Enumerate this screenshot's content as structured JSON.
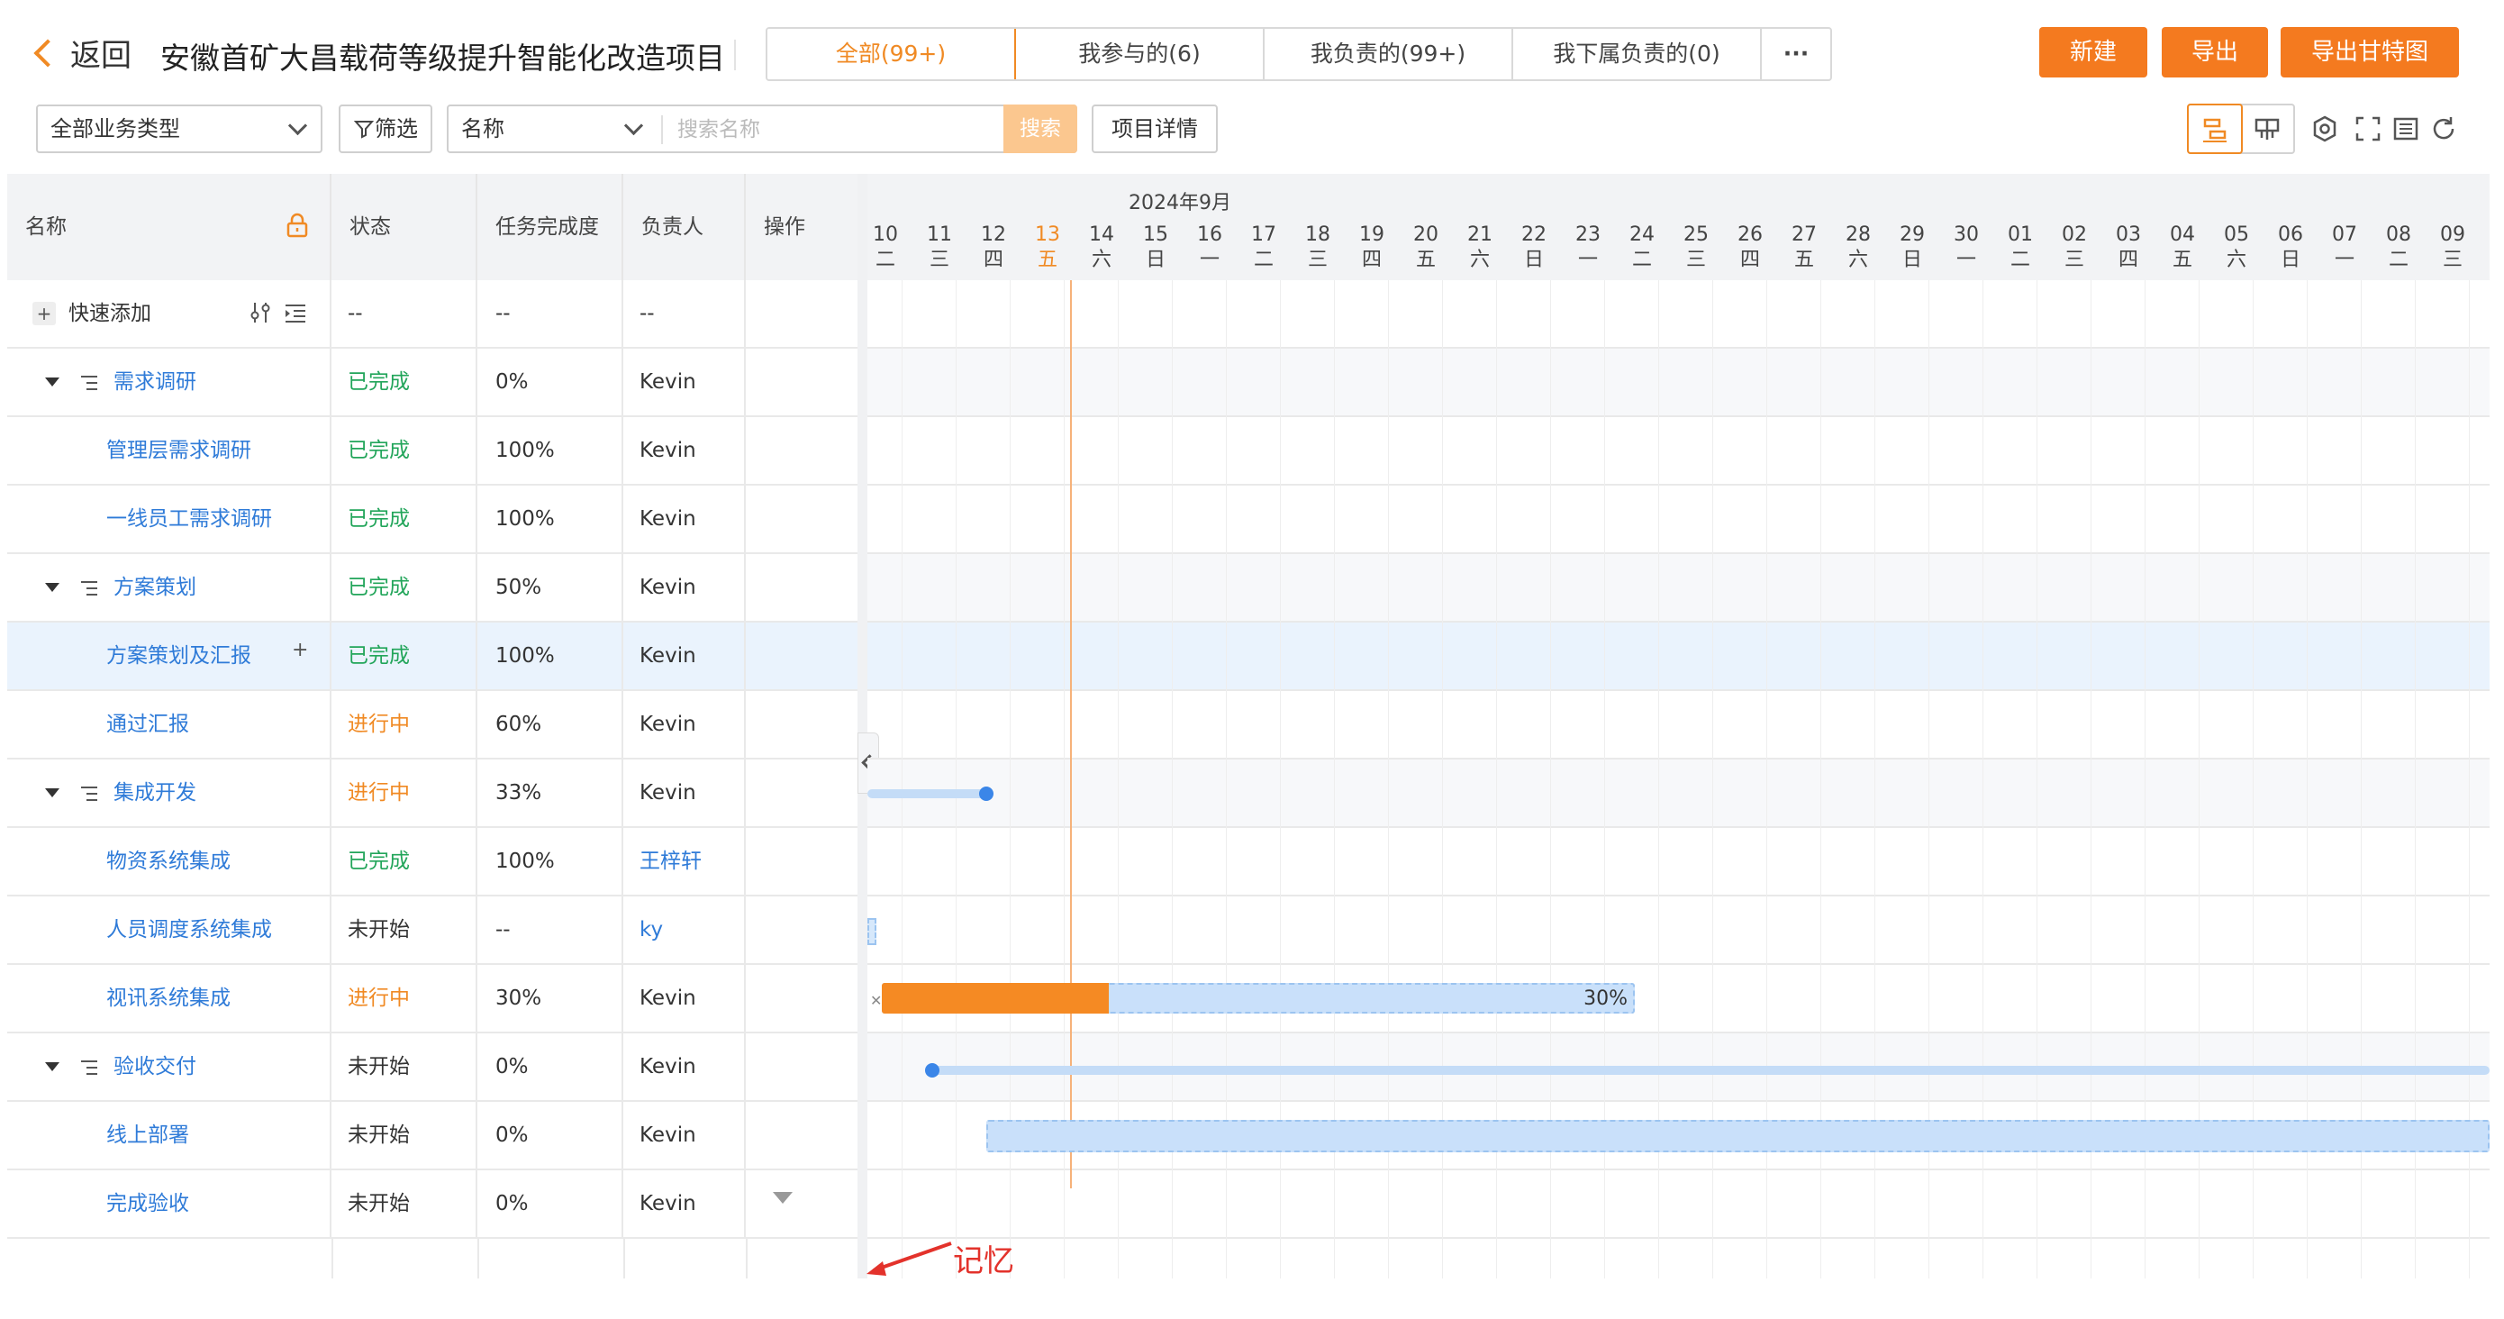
{
  "header": {
    "back_label": "返回",
    "project_title": "安徽首矿大昌载荷等级提升智能化改造项目",
    "tabs": [
      {
        "label": "全部(99+)",
        "active": true
      },
      {
        "label": "我参与的(6)",
        "active": false
      },
      {
        "label": "我负责的(99+)",
        "active": false
      },
      {
        "label": "我下属负责的(0)",
        "active": false
      }
    ],
    "more_label": "···",
    "buttons": {
      "new": "新建",
      "export": "导出",
      "export_gantt": "导出甘特图"
    },
    "accent_color": "#f47a1f"
  },
  "filters": {
    "business_type": "全部业务类型",
    "filter_label": "筛选",
    "search_field": "名称",
    "search_placeholder": "搜索名称",
    "search_button": "搜索",
    "project_detail_button": "项目详情"
  },
  "table": {
    "columns": [
      "名称",
      "状态",
      "任务完成度",
      "负责人",
      "操作"
    ],
    "quick_add": {
      "label": "快速添加",
      "status": "--",
      "progress": "--",
      "owner": "--"
    },
    "rows": [
      {
        "name": "需求调研",
        "level": 0,
        "group": true,
        "status": "已完成",
        "status_kind": "done",
        "progress": "0%",
        "owner": "Kevin"
      },
      {
        "name": "管理层需求调研",
        "level": 1,
        "group": false,
        "status": "已完成",
        "status_kind": "done",
        "progress": "100%",
        "owner": "Kevin"
      },
      {
        "name": "一线员工需求调研",
        "level": 1,
        "group": false,
        "status": "已完成",
        "status_kind": "done",
        "progress": "100%",
        "owner": "Kevin"
      },
      {
        "name": "方案策划",
        "level": 0,
        "group": true,
        "status": "已完成",
        "status_kind": "done",
        "progress": "50%",
        "owner": "Kevin"
      },
      {
        "name": "方案策划及汇报",
        "level": 1,
        "group": false,
        "status": "已完成",
        "status_kind": "done",
        "progress": "100%",
        "owner": "Kevin",
        "highlight": true,
        "row_add": "+"
      },
      {
        "name": "通过汇报",
        "level": 1,
        "group": false,
        "status": "进行中",
        "status_kind": "running",
        "progress": "60%",
        "owner": "Kevin"
      },
      {
        "name": "集成开发",
        "level": 0,
        "group": true,
        "status": "进行中",
        "status_kind": "running",
        "progress": "33%",
        "owner": "Kevin"
      },
      {
        "name": "物资系统集成",
        "level": 1,
        "group": false,
        "status": "已完成",
        "status_kind": "done",
        "progress": "100%",
        "owner": "王梓轩",
        "owner_link": true
      },
      {
        "name": "人员调度系统集成",
        "level": 1,
        "group": false,
        "status": "未开始",
        "status_kind": "none",
        "progress": "--",
        "owner": "ky",
        "owner_link": true
      },
      {
        "name": "视讯系统集成",
        "level": 1,
        "group": false,
        "status": "进行中",
        "status_kind": "running",
        "progress": "30%",
        "owner": "Kevin"
      },
      {
        "name": "验收交付",
        "level": 0,
        "group": true,
        "status": "未开始",
        "status_kind": "none",
        "progress": "0%",
        "owner": "Kevin"
      },
      {
        "name": "线上部署",
        "level": 1,
        "group": false,
        "status": "未开始",
        "status_kind": "none",
        "progress": "0%",
        "owner": "Kevin"
      },
      {
        "name": "完成验收",
        "level": 1,
        "group": false,
        "status": "未开始",
        "status_kind": "none",
        "progress": "0%",
        "owner": "Kevin"
      }
    ]
  },
  "gantt": {
    "month_label": "2024年9月",
    "days": [
      {
        "d": "10",
        "w": "二"
      },
      {
        "d": "11",
        "w": "三"
      },
      {
        "d": "12",
        "w": "四"
      },
      {
        "d": "13",
        "w": "五",
        "today": true
      },
      {
        "d": "14",
        "w": "六"
      },
      {
        "d": "15",
        "w": "日"
      },
      {
        "d": "16",
        "w": "一"
      },
      {
        "d": "17",
        "w": "二"
      },
      {
        "d": "18",
        "w": "三"
      },
      {
        "d": "19",
        "w": "四"
      },
      {
        "d": "20",
        "w": "五"
      },
      {
        "d": "21",
        "w": "六"
      },
      {
        "d": "22",
        "w": "日"
      },
      {
        "d": "23",
        "w": "一"
      },
      {
        "d": "24",
        "w": "二"
      },
      {
        "d": "25",
        "w": "三"
      },
      {
        "d": "26",
        "w": "四"
      },
      {
        "d": "27",
        "w": "五"
      },
      {
        "d": "28",
        "w": "六"
      },
      {
        "d": "29",
        "w": "日"
      },
      {
        "d": "30",
        "w": "一"
      },
      {
        "d": "01",
        "w": "二"
      },
      {
        "d": "02",
        "w": "三"
      },
      {
        "d": "03",
        "w": "四"
      },
      {
        "d": "04",
        "w": "五"
      },
      {
        "d": "05",
        "w": "六"
      },
      {
        "d": "06",
        "w": "日"
      },
      {
        "d": "07",
        "w": "一"
      },
      {
        "d": "08",
        "w": "二"
      },
      {
        "d": "09",
        "w": "三"
      }
    ],
    "today_color": "#f08a24",
    "bar_progress_label": "30%",
    "annotation": "记忆"
  }
}
